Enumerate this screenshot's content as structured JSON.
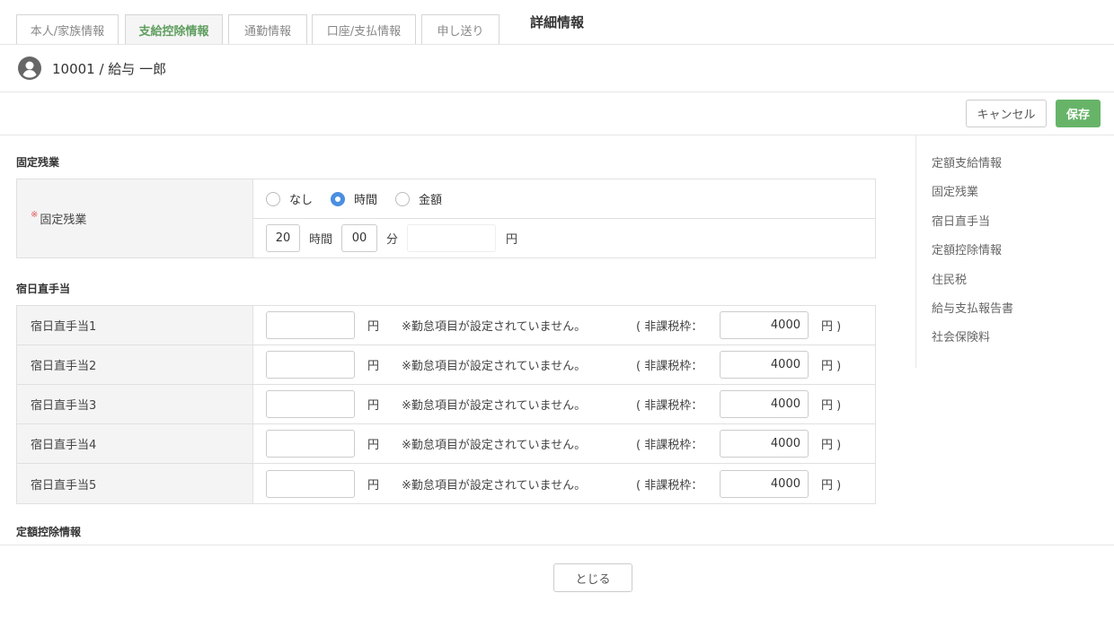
{
  "header": {
    "title": "詳細情報"
  },
  "user": {
    "label": "10001 / 給与 一郎"
  },
  "tabs": [
    {
      "label": "本人/家族情報",
      "active": false
    },
    {
      "label": "支給控除情報",
      "active": true
    },
    {
      "label": "通勤情報",
      "active": false
    },
    {
      "label": "口座/支払情報",
      "active": false
    },
    {
      "label": "申し送り",
      "active": false
    }
  ],
  "actions": {
    "cancel": "キャンセル",
    "save": "保存"
  },
  "right_nav": [
    "定額支給情報",
    "固定残業",
    "宿日直手当",
    "定額控除情報",
    "住民税",
    "給与支払報告書",
    "社会保険料"
  ],
  "fixed_overtime": {
    "section_title": "固定残業",
    "required_mark": "※",
    "label": "固定残業",
    "radio_options": [
      {
        "label": "なし",
        "checked": false
      },
      {
        "label": "時間",
        "checked": true
      },
      {
        "label": "金額",
        "checked": false
      }
    ],
    "hours_value": "20",
    "hours_unit": "時間",
    "minutes_value": "00",
    "minutes_unit": "分",
    "amount_value": "",
    "amount_unit": "円"
  },
  "night_duty": {
    "section_title": "宿日直手当",
    "yen": "円",
    "notice": "※勤怠項目が設定されていません。",
    "tax_free_open": "( 非課税枠：",
    "tax_free_close": "円 )",
    "rows": [
      {
        "label": "宿日直手当1",
        "value": "",
        "tax_free": "4000"
      },
      {
        "label": "宿日直手当2",
        "value": "",
        "tax_free": "4000"
      },
      {
        "label": "宿日直手当3",
        "value": "",
        "tax_free": "4000"
      },
      {
        "label": "宿日直手当4",
        "value": "",
        "tax_free": "4000"
      },
      {
        "label": "宿日直手当5",
        "value": "",
        "tax_free": "4000"
      }
    ]
  },
  "fixed_deduction": {
    "section_title": "定額控除情報"
  },
  "footer": {
    "close": "とじる"
  },
  "colors": {
    "accent_green": "#67b468",
    "radio_blue": "#4a8fe0",
    "required_red": "#e05a5a"
  }
}
